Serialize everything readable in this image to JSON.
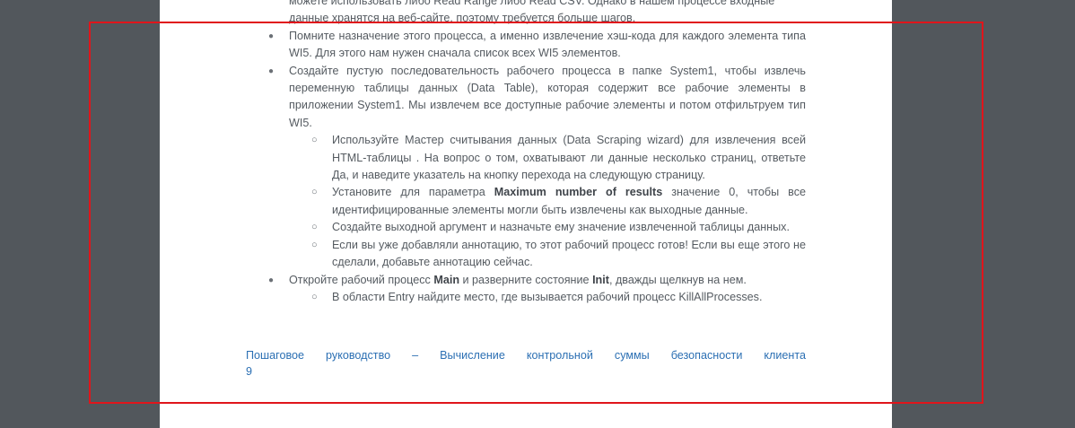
{
  "document": {
    "partial_top_1": "можете использовать либо Read Range либо Read CSV. Однако в нашем процессе входные",
    "partial_top_2": "данные хранятся на веб-сайте, поэтому требуется больше шагов.",
    "bullet_1": "Помните назначение этого процесса, а именно извлечение хэш-кода для каждого элемента типа WI5. Для этого нам нужен сначала список всех WI5 элементов.",
    "bullet_2": "Создайте пустую последовательность рабочего процесса в папке System1, чтобы извлечь переменную таблицы данных (Data Table), которая содержит все рабочие элементы в приложении System1. Мы извлечем все доступные рабочие элементы и потом отфильтруем тип WI5.",
    "sub_1": "Используйте Мастер считывания данных (Data Scraping wizard) для извлечения всей HTML-таблицы . На вопрос о том, охватывают ли данные несколько страниц, ответьте Да, и наведите указатель на кнопку перехода на следующую страницу.",
    "sub_2_pre": "Установите для параметра ",
    "sub_2_bold": "Maximum number of results",
    "sub_2_post": "  значение 0, чтобы все идентифицированные элементы могли быть извлечены как выходные данные.",
    "sub_3": "Создайте выходной аргумент и назначьте ему значение извлеченной таблицы данных.",
    "sub_4": "Если вы уже добавляли аннотацию, то этот рабочий процесс готов! Если вы еще этого не сделали, добавьте аннотацию сейчас.",
    "bullet_3_pre": "Откройте рабочий процесс ",
    "bullet_3_bold1": "Main",
    "bullet_3_mid": " и разверните состояние ",
    "bullet_3_bold2": "Init",
    "bullet_3_post": ", дважды щелкнув на нем.",
    "sub_5": "В области Entry найдите место, где вызывается рабочий процесс KillAllProcesses.",
    "footer_link": "Пошаговое руководство – Вычисление контрольной суммы безопасности клиента",
    "footer_page": "9"
  },
  "symbols": {
    "bullet": "●",
    "sub_bullet": "○"
  },
  "colors": {
    "background": "#52575c",
    "page": "#ffffff",
    "text": "#555b61",
    "link": "#2b6fb3",
    "highlight": "#e0151b"
  }
}
